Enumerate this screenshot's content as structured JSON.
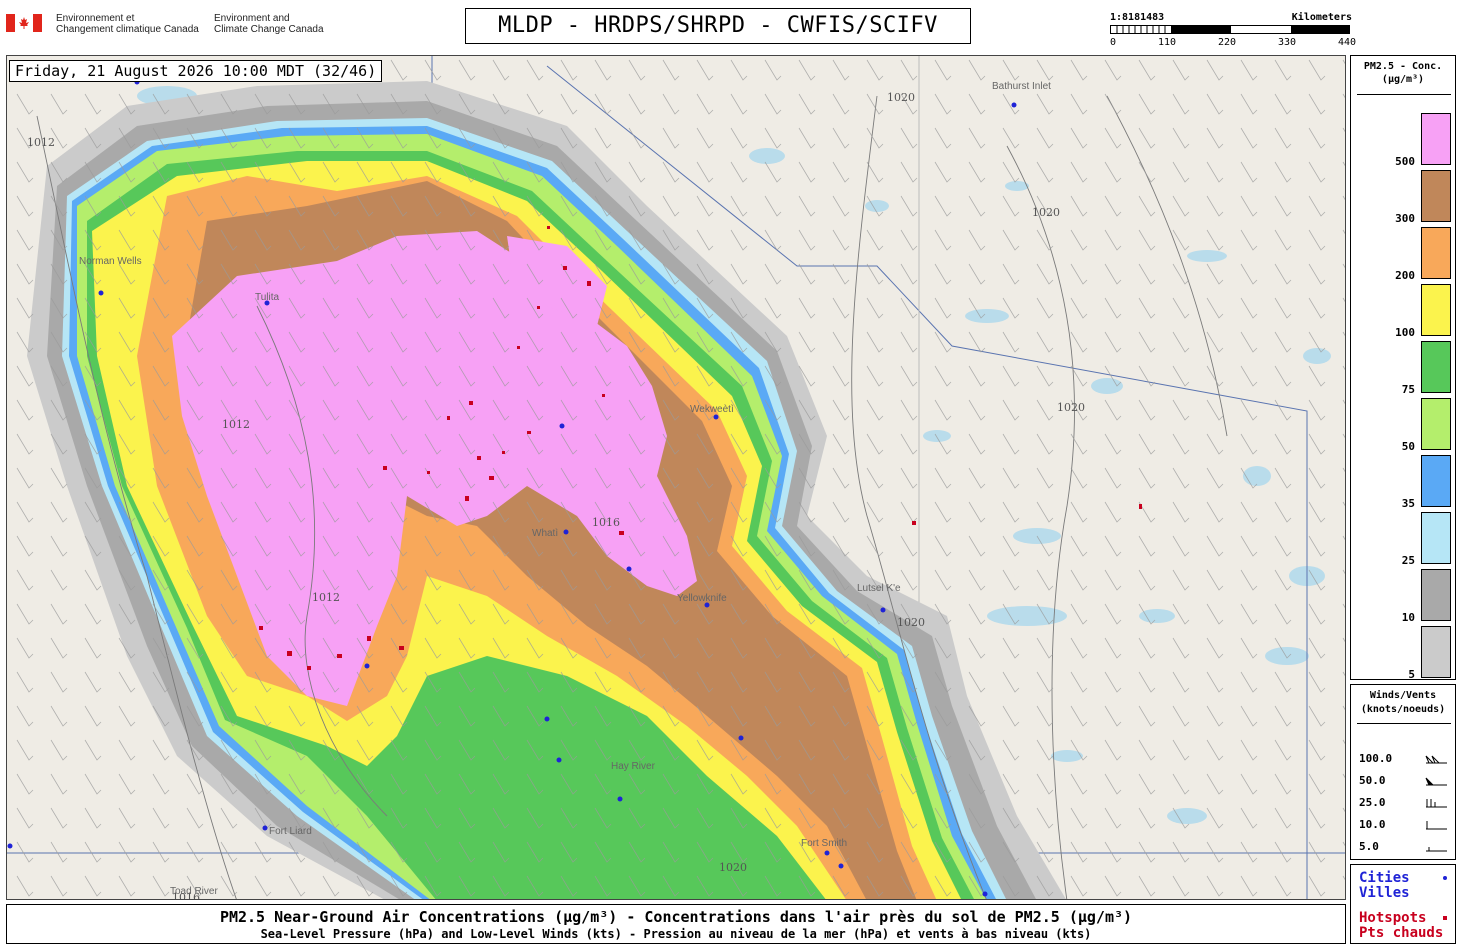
{
  "header": {
    "dept_fr": [
      "Environnement et",
      "Changement climatique Canada"
    ],
    "dept_en": [
      "Environment and",
      "Climate Change Canada"
    ],
    "title": "MLDP - HRDPS/SHRPD - CWFIS/SCIFV"
  },
  "scale": {
    "ratio": "1:8181483",
    "unit": "Kilometers",
    "ticks": [
      "0",
      "110",
      "220",
      "330",
      "440"
    ]
  },
  "timestamp": "Friday, 21 August 2026 10:00 MDT (32/46)",
  "legend": {
    "title": [
      "PM2.5 - Conc.",
      "(µg/m³)"
    ],
    "bins": [
      {
        "label": "500",
        "color": "#f7a1f5"
      },
      {
        "label": "300",
        "color": "#c0875a"
      },
      {
        "label": "200",
        "color": "#f8a85a"
      },
      {
        "label": "100",
        "color": "#fbf34d"
      },
      {
        "label": "75",
        "color": "#57c85a"
      },
      {
        "label": "50",
        "color": "#b4ee6c"
      },
      {
        "label": "35",
        "color": "#5aa9f5"
      },
      {
        "label": "25",
        "color": "#b6e6f6"
      },
      {
        "label": "10",
        "color": "#a9a9a9"
      },
      {
        "label": "5",
        "color": "#cbcbcb"
      }
    ]
  },
  "winds": {
    "title": [
      "Winds/Vents",
      "(knots/noeuds)"
    ],
    "rows": [
      "100.0",
      "50.0",
      "25.0",
      "10.0",
      "5.0"
    ]
  },
  "keys": {
    "cities": [
      "Cities",
      "Villes"
    ],
    "hotspots": [
      "Hotspots",
      "Pts chauds"
    ],
    "city_color": "#1f23d6",
    "hotspot_color": "#c8001e"
  },
  "map": {
    "place_names": [
      "Bathurst Inlet",
      "Norman Wells",
      "Tulita",
      "Wekweètì",
      "Whatì",
      "Yellowknife",
      "Hay River",
      "Fort Liard",
      "Fort Smith",
      "Toad River",
      "Lutsel K'e"
    ],
    "isobars": [
      "1012",
      "1016",
      "1020"
    ]
  },
  "footer": {
    "line1": "PM2.5 Near-Ground Air Concentrations (µg/m³) - Concentrations dans l'air près du sol de PM2.5 (µg/m³)",
    "line2": "Sea-Level Pressure (hPa) and Low-Level Winds (kts) - Pression au niveau de la mer (hPa) et vents à bas niveau (kts)"
  }
}
